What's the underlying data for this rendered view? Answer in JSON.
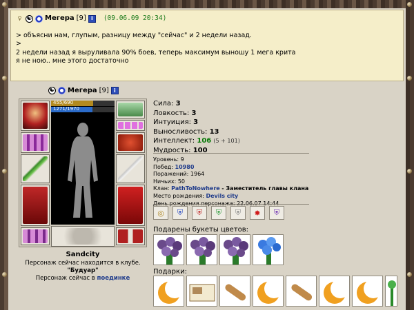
{
  "post": {
    "nick": "Мегера",
    "level": "[9]",
    "timestamp": "(09.06.09 20:34)",
    "lines": [
      "> объясни нам, глупым, разницу между \"сейчас\" и 2 недели назад.",
      ">",
      "",
      "2 недели назад я выруливала 90% боев, теперь максимум выношу 1 мега крита",
      "я не ною.. мне этого достаточно"
    ]
  },
  "profile": {
    "nick": "Мегера",
    "level": "[9]",
    "hp_text": "455/690",
    "hp_fraction": 0.66,
    "mp_text": "1271/1970",
    "mp_fraction": 0.65
  },
  "stats": {
    "strength_label": "Сила:",
    "strength": "3",
    "agility_label": "Ловкость:",
    "agility": "3",
    "intuition_label": "Интуиция:",
    "intuition": "3",
    "endurance_label": "Выносливость:",
    "endurance": "13",
    "intellect_label": "Интеллект:",
    "intellect": "106",
    "intellect_detail": "(5 + 101)",
    "wisdom_label": "Мудрость:",
    "wisdom": "100"
  },
  "info": {
    "level_label": "Уровень:",
    "level": "9",
    "wins_label": "Побед:",
    "wins": "10980",
    "losses_label": "Поражений:",
    "losses": "1964",
    "draws_label": "Ничьих:",
    "draws": "50",
    "clan_label": "Клан:",
    "clan": "PathToNowhere",
    "clan_role": "- Заместитель главы клана",
    "birthplace_label": "Место рождения:",
    "birthplace": "Devils city",
    "birthday_label": "День рождения персонажа:",
    "birthday": "22.06.07 14:44"
  },
  "location": {
    "city": "Sandcity",
    "line1": "Персонаж сейчас находится в клубе.",
    "club": "\"Будуар\"",
    "line3_prefix": "Персонаж сейчас в",
    "line3_link": "поединке"
  },
  "labels": {
    "bouquets": "Подарены букеты цветов:",
    "gifts": "Подарки:"
  },
  "colors": {
    "post_bg": "#f5eec9",
    "page_bg": "#d9d3c6",
    "link": "#1e3a8a",
    "timestamp": "#1b7a1b",
    "intellect": "#0a7a0a"
  },
  "icons": {
    "badges": [
      "ring-icon",
      "shield-blue-icon",
      "shield-red-icon",
      "shield-green-icon",
      "shield-white-icon",
      "red-orb-icon",
      "shield-purple-icon"
    ],
    "bouquets": [
      "purple-roses-icon",
      "purple-roses-icon",
      "purple-roses-icon",
      "blue-flowers-icon"
    ],
    "gifts": [
      "crescent-moon-icon",
      "card-box-icon",
      "scroll-icon",
      "crescent-moon-icon",
      "scroll-icon",
      "crescent-moon-icon",
      "crescent-moon-icon",
      "plant-icon"
    ]
  }
}
